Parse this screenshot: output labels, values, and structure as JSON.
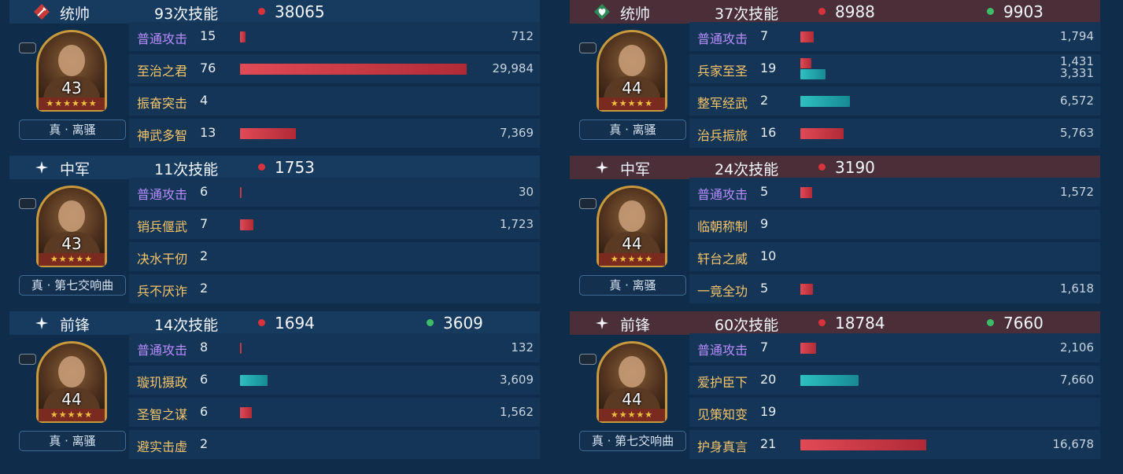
{
  "left": [
    {
      "role": "统帅",
      "role_icon": "sword-badge-icon",
      "casts": "93次技能",
      "red_stat": "38065",
      "green_stat": "",
      "level": "43",
      "stars": "★★★★★★",
      "tag": "真 · 离骚",
      "skills": [
        {
          "name": "普通攻击",
          "count": "15",
          "basic": true,
          "bars": [
            {
              "kind": "red",
              "value": 712
            }
          ],
          "labels": [
            "712"
          ]
        },
        {
          "name": "至治之君",
          "count": "76",
          "basic": false,
          "bars": [
            {
              "kind": "red",
              "value": 29984
            }
          ],
          "labels": [
            "29,984"
          ]
        },
        {
          "name": "振奋突击",
          "count": "4",
          "basic": false,
          "bars": [],
          "labels": []
        },
        {
          "name": "神武多智",
          "count": "13",
          "basic": false,
          "bars": [
            {
              "kind": "red",
              "value": 7369
            }
          ],
          "labels": [
            "7,369"
          ]
        }
      ]
    },
    {
      "role": "中军",
      "role_icon": "sparkle-icon",
      "casts": "11次技能",
      "red_stat": "1753",
      "green_stat": "",
      "level": "43",
      "stars": "★★★★★",
      "tag": "真 · 第七交响曲",
      "skills": [
        {
          "name": "普通攻击",
          "count": "6",
          "basic": true,
          "bars": [
            {
              "kind": "red",
              "value": 30
            }
          ],
          "labels": [
            "30"
          ]
        },
        {
          "name": "销兵偃武",
          "count": "7",
          "basic": false,
          "bars": [
            {
              "kind": "red",
              "value": 1723
            }
          ],
          "labels": [
            "1,723"
          ]
        },
        {
          "name": "决水干仞",
          "count": "2",
          "basic": false,
          "bars": [],
          "labels": []
        },
        {
          "name": "兵不厌诈",
          "count": "2",
          "basic": false,
          "bars": [],
          "labels": []
        }
      ]
    },
    {
      "role": "前锋",
      "role_icon": "sparkle-icon",
      "casts": "14次技能",
      "red_stat": "1694",
      "green_stat": "3609",
      "level": "44",
      "stars": "★★★★★",
      "tag": "真 · 离骚",
      "skills": [
        {
          "name": "普通攻击",
          "count": "8",
          "basic": true,
          "bars": [
            {
              "kind": "red",
              "value": 132
            }
          ],
          "labels": [
            "132"
          ]
        },
        {
          "name": "璇玑摄政",
          "count": "6",
          "basic": false,
          "bars": [
            {
              "kind": "teal",
              "value": 3609
            }
          ],
          "labels": [
            "3,609"
          ]
        },
        {
          "name": "圣智之谋",
          "count": "6",
          "basic": false,
          "bars": [
            {
              "kind": "red",
              "value": 1562
            }
          ],
          "labels": [
            "1,562"
          ]
        },
        {
          "name": "避实击虚",
          "count": "2",
          "basic": false,
          "bars": [],
          "labels": []
        }
      ]
    }
  ],
  "right": [
    {
      "role": "统帅",
      "role_icon": "heart-badge-icon",
      "casts": "37次技能",
      "red_stat": "8988",
      "green_stat": "9903",
      "level": "44",
      "stars": "★★★★★",
      "tag": "真 · 离骚",
      "skills": [
        {
          "name": "普通攻击",
          "count": "7",
          "basic": true,
          "bars": [
            {
              "kind": "red",
              "value": 1794
            }
          ],
          "labels": [
            "1,794"
          ]
        },
        {
          "name": "兵家至圣",
          "count": "19",
          "basic": false,
          "bars": [
            {
              "kind": "red",
              "value": 1431
            },
            {
              "kind": "teal",
              "value": 3331
            }
          ],
          "labels": [
            "1,431",
            "3,331"
          ]
        },
        {
          "name": "整军经武",
          "count": "2",
          "basic": false,
          "bars": [
            {
              "kind": "teal",
              "value": 6572
            }
          ],
          "labels": [
            "6,572"
          ]
        },
        {
          "name": "治兵振旅",
          "count": "16",
          "basic": false,
          "bars": [
            {
              "kind": "red",
              "value": 5763
            }
          ],
          "labels": [
            "5,763"
          ]
        }
      ]
    },
    {
      "role": "中军",
      "role_icon": "sparkle-icon",
      "casts": "24次技能",
      "red_stat": "3190",
      "green_stat": "",
      "level": "44",
      "stars": "★★★★★",
      "tag": "真 · 离骚",
      "skills": [
        {
          "name": "普通攻击",
          "count": "5",
          "basic": true,
          "bars": [
            {
              "kind": "red",
              "value": 1572
            }
          ],
          "labels": [
            "1,572"
          ]
        },
        {
          "name": "临朝称制",
          "count": "9",
          "basic": false,
          "bars": [],
          "labels": []
        },
        {
          "name": "轩台之威",
          "count": "10",
          "basic": false,
          "bars": [],
          "labels": []
        },
        {
          "name": "一竟全功",
          "count": "5",
          "basic": false,
          "bars": [
            {
              "kind": "red",
              "value": 1618
            }
          ],
          "labels": [
            "1,618"
          ]
        }
      ]
    },
    {
      "role": "前锋",
      "role_icon": "sparkle-icon",
      "casts": "60次技能",
      "red_stat": "18784",
      "green_stat": "7660",
      "level": "44",
      "stars": "★★★★★",
      "tag": "真 · 第七交响曲",
      "skills": [
        {
          "name": "普通攻击",
          "count": "7",
          "basic": true,
          "bars": [
            {
              "kind": "red",
              "value": 2106
            }
          ],
          "labels": [
            "2,106"
          ]
        },
        {
          "name": "爱护臣下",
          "count": "20",
          "basic": false,
          "bars": [
            {
              "kind": "teal",
              "value": 7660
            }
          ],
          "labels": [
            "7,660"
          ]
        },
        {
          "name": "见策知变",
          "count": "19",
          "basic": false,
          "bars": [],
          "labels": []
        },
        {
          "name": "护身真言",
          "count": "21",
          "basic": false,
          "bars": [
            {
              "kind": "red",
              "value": 16678
            }
          ],
          "labels": [
            "16,678"
          ]
        }
      ]
    }
  ],
  "colors": {
    "damage": "#d8333d",
    "heal": "#2ec0c0",
    "heal_dot": "#3dbd6a",
    "basic_skill": "#b78cff",
    "skill": "#f5c46a"
  }
}
